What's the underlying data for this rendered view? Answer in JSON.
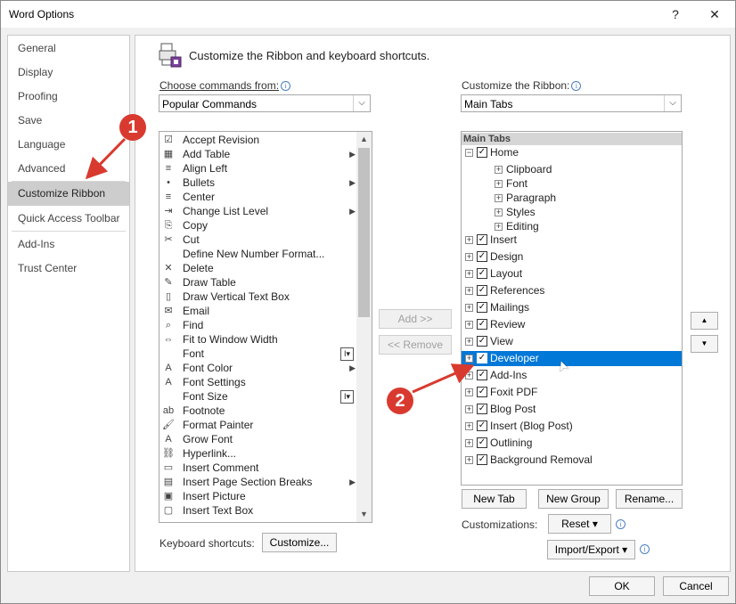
{
  "window": {
    "title": "Word Options",
    "help": "?",
    "close": "✕"
  },
  "nav": {
    "items": [
      {
        "label": "General"
      },
      {
        "label": "Display"
      },
      {
        "label": "Proofing"
      },
      {
        "label": "Save"
      },
      {
        "label": "Language"
      },
      {
        "label": "Advanced"
      },
      {
        "label": "Customize Ribbon",
        "selected": true
      },
      {
        "label": "Quick Access Toolbar"
      },
      {
        "label": "Add-Ins"
      },
      {
        "label": "Trust Center"
      }
    ]
  },
  "header": {
    "title": "Customize the Ribbon and keyboard shortcuts."
  },
  "left": {
    "label": "Choose commands from:",
    "combo_value": "Popular Commands",
    "commands": [
      "Accept Revision",
      "Add Table",
      "Align Left",
      "Bullets",
      "Center",
      "Change List Level",
      "Copy",
      "Cut",
      "Define New Number Format...",
      "Delete",
      "Draw Table",
      "Draw Vertical Text Box",
      "Email",
      "Find",
      "Fit to Window Width",
      "Font",
      "Font Color",
      "Font Settings",
      "Font Size",
      "Footnote",
      "Format Painter",
      "Grow Font",
      "Hyperlink...",
      "Insert Comment",
      "Insert Page  Section Breaks",
      "Insert Picture",
      "Insert Text Box"
    ]
  },
  "right": {
    "label": "Customize the Ribbon:",
    "combo_value": "Main Tabs",
    "tree_header": "Main Tabs",
    "home": {
      "label": "Home",
      "children": [
        "Clipboard",
        "Font",
        "Paragraph",
        "Styles",
        "Editing"
      ]
    },
    "tabs": [
      "Insert",
      "Design",
      "Layout",
      "References",
      "Mailings",
      "Review",
      "View",
      "Developer",
      "Add-Ins",
      "Foxit PDF",
      "Blog Post",
      "Insert (Blog Post)",
      "Outlining",
      "Background Removal"
    ],
    "selected_tab": "Developer"
  },
  "buttons": {
    "add": "Add >>",
    "remove": "<< Remove",
    "new_tab": "New Tab",
    "new_group": "New Group",
    "rename": "Rename...",
    "reset": "Reset",
    "import_export": "Import/Export",
    "customize": "Customize...",
    "ok": "OK",
    "cancel": "Cancel"
  },
  "labels": {
    "customizations": "Customizations:",
    "keyboard_shortcuts": "Keyboard shortcuts:"
  },
  "annotations": {
    "badge1": "1",
    "badge2": "2"
  },
  "colors": {
    "selection": "#0078d7",
    "badge": "#d93a2f",
    "arrow": "#d93a2f"
  }
}
